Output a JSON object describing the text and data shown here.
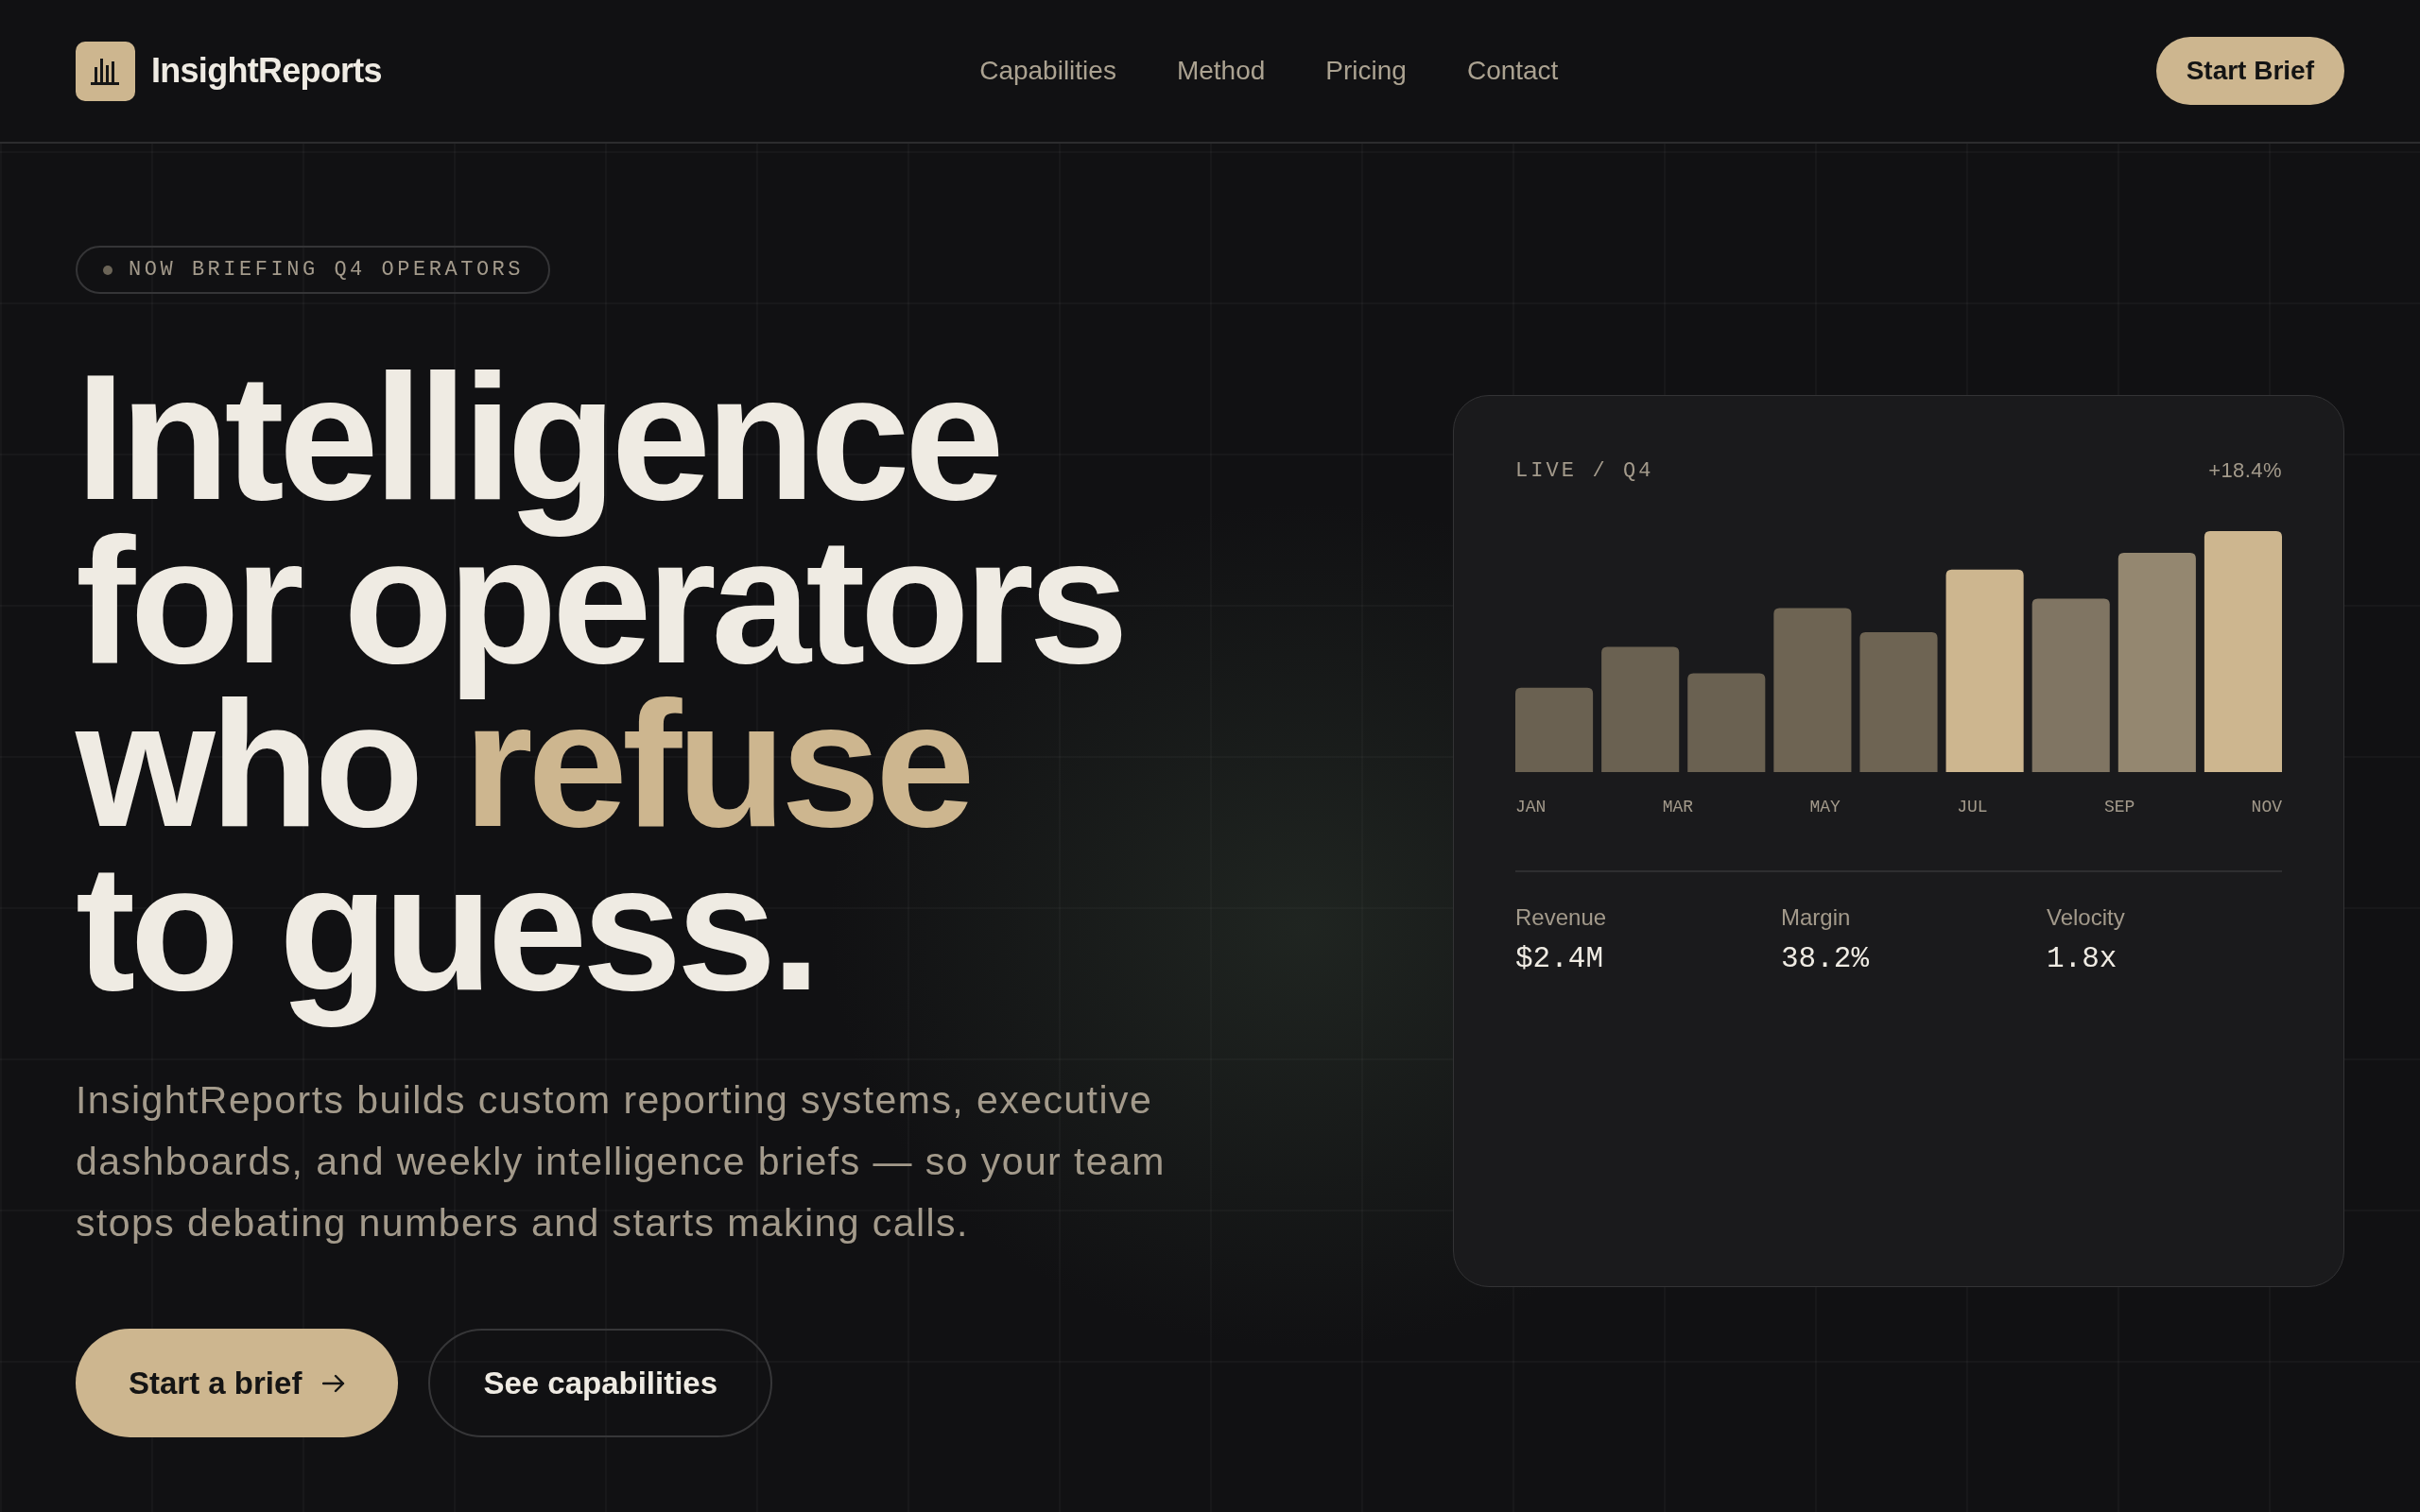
{
  "nav": {
    "brand": "InsightReports",
    "links": [
      "Capabilities",
      "Method",
      "Pricing",
      "Contact"
    ],
    "cta": "Start Brief"
  },
  "hero": {
    "badge": "NOW BRIEFING Q4 OPERATORS",
    "headline": "Intelligence for operators who **refuse** to guess.",
    "description": "InsightReports builds custom reporting systems, executive dashboards, and weekly intelligence briefs — so your team stops debating numbers and starts making calls.",
    "buttons": [
      {
        "label": "Start a brief",
        "kind": "primary"
      },
      {
        "label": "See capabilities",
        "kind": "secondary"
      }
    ]
  },
  "panel": {
    "label": "LIVE / Q4",
    "change": "+18.4%",
    "months": [
      "JAN",
      "MAR",
      "MAY",
      "JUL",
      "SEP",
      "NOV"
    ],
    "stats": [
      {
        "label": "Revenue",
        "value": "$2.4M"
      },
      {
        "label": "Margin",
        "value": "38.2%"
      },
      {
        "label": "Velocity",
        "value": "1.8x"
      }
    ]
  }
}
